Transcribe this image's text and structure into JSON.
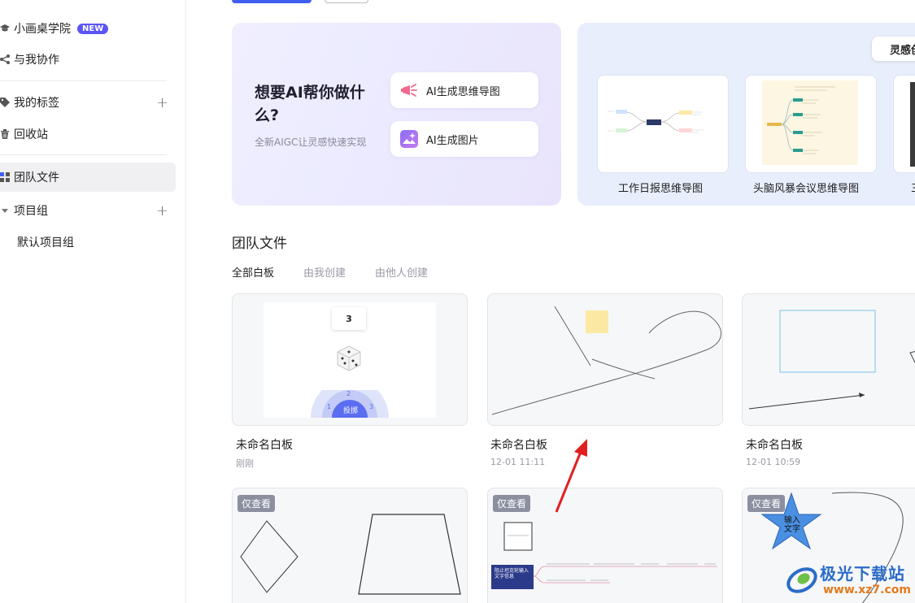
{
  "sidebar": {
    "items": [
      {
        "label": "小画桌学院",
        "badge": "NEW"
      },
      {
        "label": "与我协作"
      },
      {
        "label": "我的标签"
      },
      {
        "label": "回收站"
      },
      {
        "label": "团队文件"
      },
      {
        "label": "项目组"
      },
      {
        "label": "默认项目组"
      }
    ],
    "plus": "+"
  },
  "ai_banner": {
    "title": "想要AI帮你做什么?",
    "subtitle": "全新AIGC让灵感快速实现",
    "buttons": [
      {
        "label": "AI生成思维导图",
        "icon": "mindmap-ai-icon"
      },
      {
        "label": "AI生成图片",
        "icon": "image-ai-icon"
      }
    ]
  },
  "templates": {
    "tab_label": "灵感创",
    "items": [
      {
        "label": "工作日报思维导图"
      },
      {
        "label": "头脑风暴会议思维导图"
      },
      {
        "label": "三"
      }
    ]
  },
  "team": {
    "title": "团队文件",
    "tabs": [
      "全部白板",
      "由我创建",
      "由他人创建"
    ],
    "files": [
      {
        "name": "未命名白板",
        "time": "刚刚",
        "dice_value": "3",
        "wheel_label": "投掷",
        "wheel_numbers": [
          "1",
          "2",
          "3"
        ]
      },
      {
        "name": "未命名白板",
        "time": "12-01 11:11"
      },
      {
        "name": "未命名白板",
        "time": "12-01 10:59"
      },
      {
        "badge": "仅查看"
      },
      {
        "badge": "仅查看",
        "mindmap_root": "阻止坦克轮输入文字信息"
      },
      {
        "badge": "仅查看",
        "star_text": "输入文字"
      }
    ]
  },
  "watermark": {
    "text": "极光下载站",
    "url": "www.xz7.com"
  },
  "colors": {
    "accent": "#3f5ef2",
    "badge_new": "#5b55f6",
    "arrow": "#e02020"
  }
}
